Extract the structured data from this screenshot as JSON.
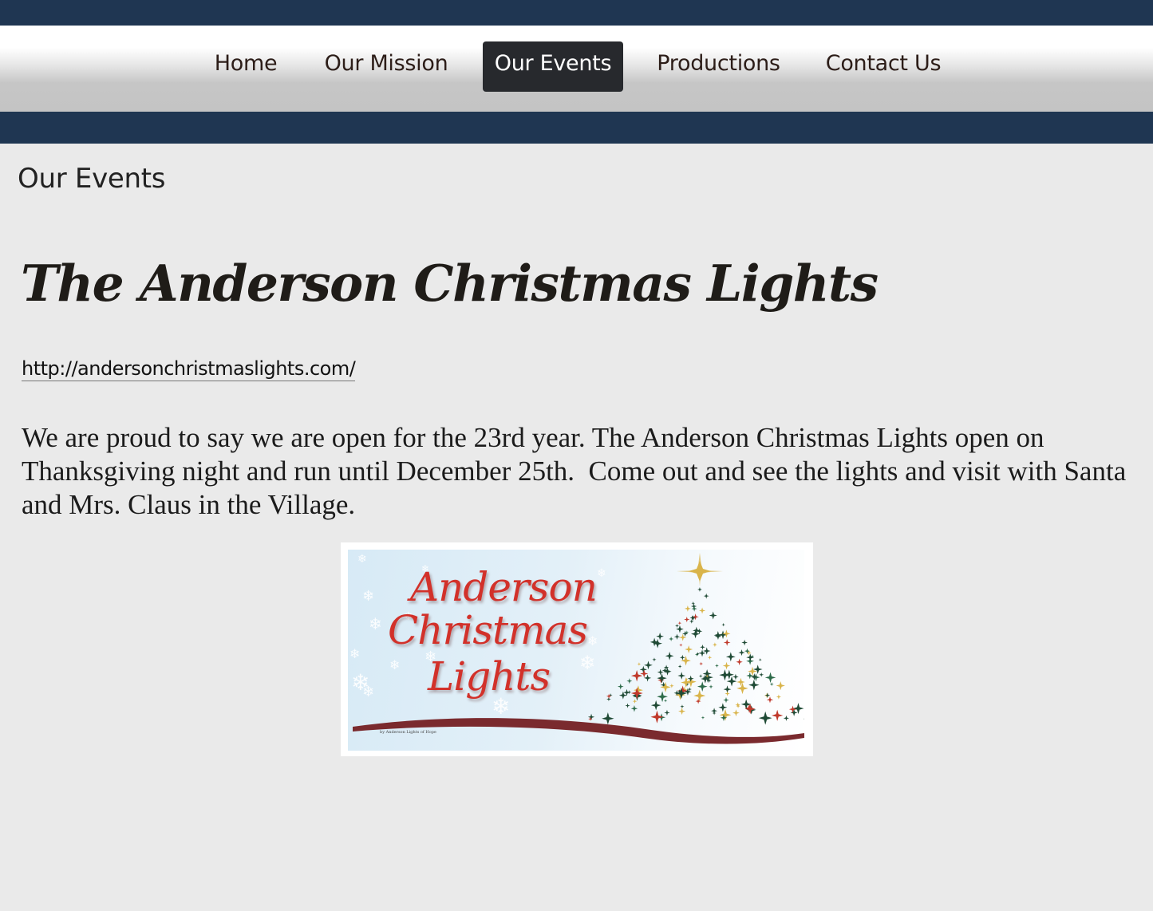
{
  "nav": {
    "items": [
      {
        "label": "Home",
        "active": false
      },
      {
        "label": "Our Mission",
        "active": false
      },
      {
        "label": "Our Events",
        "active": true
      },
      {
        "label": "Productions",
        "active": false
      },
      {
        "label": "Contact Us",
        "active": false
      }
    ]
  },
  "page": {
    "title": "Our Events"
  },
  "event": {
    "heading": "The Anderson Christmas Lights",
    "link": "http://andersonchristmaslights.com/",
    "description": "We are proud to say we are open for the 23rd year. The Anderson Christmas Lights open on Thanksgiving night and run until December 25th.  Come out and see the lights and visit with Santa and Mrs. Claus in the Village.",
    "banner": {
      "lines": [
        "Anderson",
        "Christmas",
        "Lights"
      ],
      "credit": "by Anderson Lights of Hope"
    }
  },
  "colors": {
    "band": "#1f3652",
    "nav_active": "#27292d",
    "banner_text": "#d2312a",
    "swoosh": "#7a2a2e",
    "tree": "#1f4a35"
  }
}
